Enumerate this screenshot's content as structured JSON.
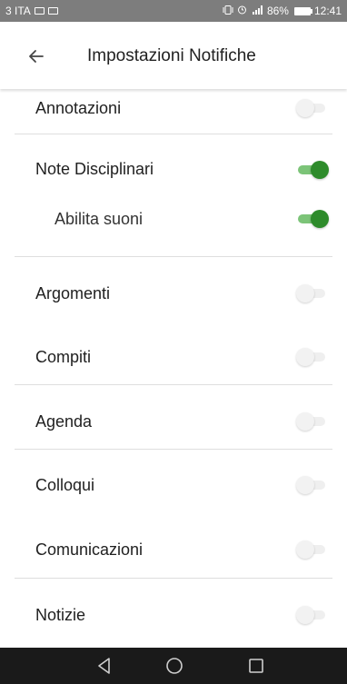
{
  "status_bar": {
    "carrier": "3 ITA",
    "battery_percent": "86%",
    "time": "12:41",
    "icons": [
      "image-notification-icon",
      "image-notification-icon",
      "vibrate-icon",
      "alarm-icon",
      "signal-icon",
      "battery-icon"
    ]
  },
  "app_bar": {
    "title": "Impostazioni Notifiche",
    "back_icon": "arrow-left-icon"
  },
  "settings": [
    {
      "label": "Annotazioni",
      "enabled": false
    },
    {
      "label": "Note Disciplinari",
      "enabled": true
    },
    {
      "label": "Abilita suoni",
      "enabled": true,
      "sub": true
    },
    {
      "label": "Argomenti",
      "enabled": false
    },
    {
      "label": "Compiti",
      "enabled": false
    },
    {
      "label": "Agenda",
      "enabled": false
    },
    {
      "label": "Colloqui",
      "enabled": false
    },
    {
      "label": "Comunicazioni",
      "enabled": false
    },
    {
      "label": "Notizie",
      "enabled": false
    }
  ],
  "nav_bar": {
    "buttons": [
      "back-triangle-icon",
      "home-circle-icon",
      "recents-square-icon"
    ]
  },
  "colors": {
    "accent_green": "#2e8b2b",
    "accent_green_track": "#7cc478",
    "status_bar": "#7d7d7d",
    "nav_bar": "#1a1a1a"
  }
}
